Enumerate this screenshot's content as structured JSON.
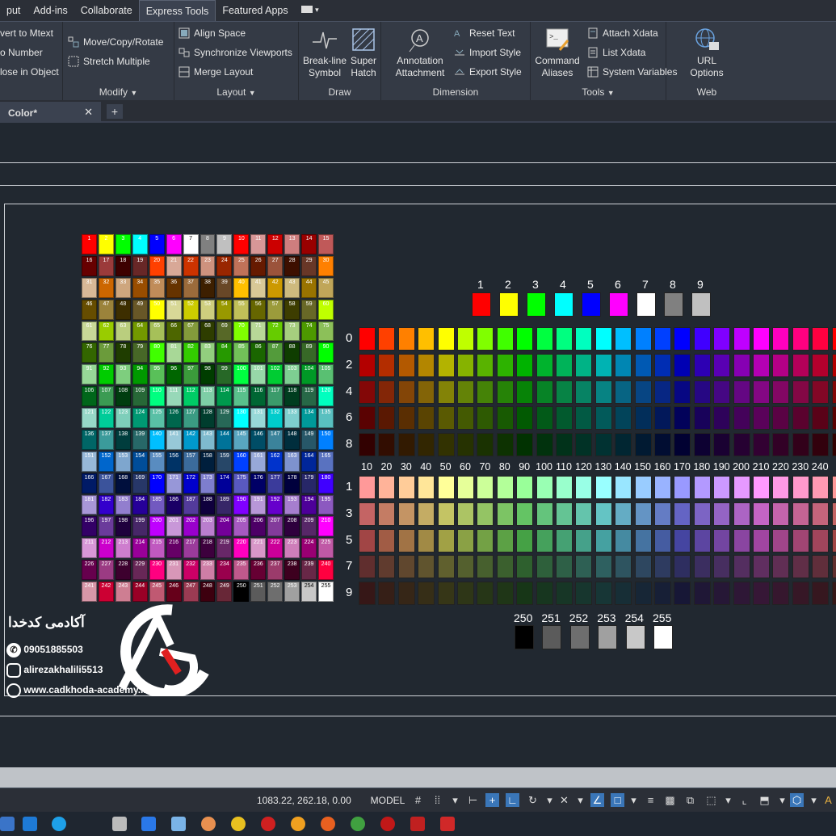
{
  "menu_tabs": [
    "put",
    "Add-ins",
    "Collaborate",
    "Express Tools",
    "Featured Apps",
    "▾"
  ],
  "active_tab": "Express Tools",
  "ribbon": {
    "text_panel": {
      "items": [
        "vert to Mtext",
        "o Number",
        "lose in Object"
      ]
    },
    "modify_panel": {
      "items": [
        "Move/Copy/Rotate",
        "Stretch Multiple"
      ],
      "title": "Modify"
    },
    "layout_panel": {
      "items": [
        "Align Space",
        "Synchronize Viewports",
        "Merge Layout"
      ],
      "title": "Layout"
    },
    "draw_panel": {
      "breakline": "Break-line\nSymbol",
      "superhatch": "Super\nHatch",
      "title": "Draw"
    },
    "dimension_panel": {
      "annotation": "Annotation\nAttachment",
      "items": [
        "Reset Text",
        "Import Style",
        "Export Style"
      ],
      "title": "Dimension"
    },
    "tools_panel": {
      "command": "Command\nAliases",
      "items": [
        "Attach Xdata",
        "List Xdata",
        "System Variables"
      ],
      "title": "Tools"
    },
    "web_panel": {
      "url": "URL\nOptions",
      "title": "Web"
    }
  },
  "doc_tab": {
    "label": "Color*",
    "close": "✕",
    "add": "+"
  },
  "aci_standard": {
    "labels": [
      "1",
      "2",
      "3",
      "4",
      "5",
      "6",
      "7",
      "8",
      "9"
    ],
    "colors": [
      "#ff0000",
      "#ffff00",
      "#00ff00",
      "#00ffff",
      "#0000ff",
      "#ff00ff",
      "#ffffff",
      "#808080",
      "#c0c0c0"
    ]
  },
  "hue_labels": [
    "10",
    "20",
    "30",
    "40",
    "50",
    "60",
    "70",
    "80",
    "90",
    "100",
    "110",
    "120",
    "130",
    "140",
    "150",
    "160",
    "170",
    "180",
    "190",
    "200",
    "210",
    "220",
    "230",
    "240"
  ],
  "upper_rows": [
    "0",
    "2",
    "4",
    "6",
    "8"
  ],
  "lower_rows": [
    "1",
    "3",
    "5",
    "7",
    "9"
  ],
  "grays": {
    "labels": [
      "250",
      "251",
      "252",
      "253",
      "254",
      "255"
    ],
    "colors": [
      "#000000",
      "#5b5b5b",
      "#6e6e6e",
      "#a0a0a0",
      "#c8c8c8",
      "#ffffff"
    ]
  },
  "grid_labels": [
    "1",
    "2",
    "3",
    "4",
    "5",
    "6",
    "7",
    "8",
    "9",
    "10",
    "11",
    "12",
    "13",
    "14",
    "15",
    "16",
    "17",
    "18",
    "19",
    "20",
    "21",
    "22",
    "23",
    "24",
    "25",
    "26",
    "27",
    "28",
    "29",
    "30",
    "31",
    "32",
    "33",
    "34",
    "35",
    "36",
    "37",
    "38",
    "39",
    "40",
    "41",
    "42",
    "43",
    "44",
    "45",
    "46",
    "47",
    "48",
    "49",
    "50",
    "51",
    "52",
    "53",
    "54",
    "55",
    "56",
    "57",
    "58",
    "59",
    "60",
    "61",
    "62",
    "63",
    "64",
    "65",
    "66",
    "67",
    "68",
    "69",
    "70",
    "71",
    "72",
    "73",
    "74",
    "75",
    "76",
    "77",
    "78",
    "79",
    "80",
    "81",
    "82",
    "83",
    "84",
    "85",
    "86",
    "87",
    "88",
    "89",
    "90",
    "91",
    "92",
    "93",
    "94",
    "95",
    "96",
    "97",
    "98",
    "99",
    "100",
    "101",
    "102",
    "103",
    "104",
    "105",
    "106",
    "107",
    "108",
    "109",
    "110",
    "111",
    "112",
    "113",
    "114",
    "115",
    "116",
    "117",
    "118",
    "119",
    "120",
    "121",
    "122",
    "123",
    "124",
    "125",
    "126",
    "127",
    "128",
    "129",
    "130",
    "131",
    "132",
    "133",
    "134",
    "135",
    "136",
    "137",
    "138",
    "139",
    "140",
    "141",
    "142",
    "143",
    "144",
    "145",
    "146",
    "147",
    "148",
    "149",
    "150",
    "151",
    "152",
    "153",
    "154",
    "155",
    "156",
    "157",
    "158",
    "159",
    "160",
    "161",
    "162",
    "163",
    "164",
    "165",
    "166",
    "167",
    "168",
    "169",
    "170",
    "171",
    "172",
    "173",
    "174",
    "175",
    "176",
    "177",
    "178",
    "179",
    "180",
    "181",
    "182",
    "183",
    "184",
    "185",
    "186",
    "187",
    "188",
    "189",
    "190",
    "191",
    "192",
    "193",
    "194",
    "195",
    "196",
    "197",
    "198",
    "199",
    "200",
    "201",
    "202",
    "203",
    "204",
    "205",
    "206",
    "207",
    "208",
    "209",
    "210",
    "211",
    "212",
    "213",
    "214",
    "215",
    "216",
    "217",
    "218",
    "219",
    "220",
    "221",
    "222",
    "223",
    "224",
    "225",
    "226",
    "227",
    "228",
    "229",
    "230",
    "231",
    "232",
    "233",
    "234",
    "235",
    "236",
    "237",
    "238",
    "239",
    "240",
    "241",
    "242",
    "243",
    "244",
    "245",
    "246",
    "247",
    "248",
    "249",
    "250",
    "251",
    "252",
    "253",
    "254",
    "255"
  ],
  "branding": {
    "title": "آکادمی کدخدا",
    "phone": "09051885503",
    "instagram": "alirezakhalili5513",
    "website": "www.cadkhoda-academy.ir"
  },
  "status": {
    "coords": "1083.22, 262.18, 0.00",
    "model": "MODEL"
  }
}
